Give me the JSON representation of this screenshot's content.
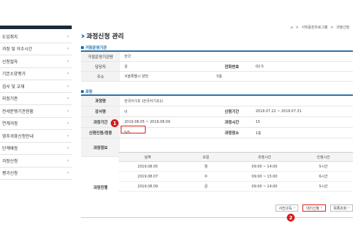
{
  "breadcrumb": {
    "home": "⌂",
    "sep1": ">",
    "item1": "사직동한프로그램",
    "sep2": ">",
    "item2": "과정신청"
  },
  "sidebar": {
    "items": [
      {
        "label": "도입취지"
      },
      {
        "label": "과정 및 이수시간"
      },
      {
        "label": "신청절차"
      },
      {
        "label": "기본소양평가"
      },
      {
        "label": "검사 및 교재"
      },
      {
        "label": "지정기준"
      },
      {
        "label": "전세분쟁기관현황"
      },
      {
        "label": "연계과정"
      },
      {
        "label": "영주귀화신청안내"
      },
      {
        "label": "단계배정"
      },
      {
        "label": "과정신청"
      },
      {
        "label": "평가신청"
      }
    ]
  },
  "page": {
    "title": "과정신청 관리"
  },
  "org_section": {
    "title": "거점운영기관",
    "name_label": "거점운영기관명",
    "name_value": "한국",
    "manager_label": "담당자",
    "manager_value": "김",
    "phone_label": "전화번호",
    "phone_value": "02-5",
    "address_label": "주소",
    "address_value": "서울특별시 양천",
    "address_extra": "5층"
  },
  "course_section": {
    "title": "과정",
    "course_label": "과정명",
    "course_value": "한국어기초 (한국어기초1)",
    "instructor_label": "강사명",
    "instructor_value": "이",
    "apply_period_label": "신청기간",
    "apply_period_value": "2019.07.22 ~ 2019.07.31",
    "course_period_label": "과정기간",
    "course_period_value": "2019.08.05 ~ 2019.08.09",
    "course_hours_label": "과정시간",
    "course_hours_value": "15",
    "capacity_label": "신청인원/정원",
    "capacity_value": "5/5",
    "location_label": "과정장소",
    "location_value": "1층",
    "info_label": "과정정보",
    "schedule_label": "과정진행"
  },
  "schedule": {
    "headers": [
      "날짜",
      "요일",
      "과정시간",
      "인정시간"
    ],
    "rows": [
      {
        "date": "2019.08.05",
        "day": "월",
        "time": "09:00 ~ 14:00",
        "credit": "5시간"
      },
      {
        "date": "2019.08.07",
        "day": "수",
        "time": "09:00 ~ 15:00",
        "credit": "6시간"
      },
      {
        "date": "2019.08.09",
        "day": "금",
        "time": "09:00 ~ 14:00",
        "credit": "5시간"
      }
    ]
  },
  "badges": {
    "one": "1",
    "two": "2"
  },
  "buttons": {
    "apply": "사전고득",
    "waitlist": "대기신청",
    "list": "목록조회",
    "arrow": "›"
  },
  "colors": {
    "accent": "#1a6fa6",
    "highlight": "#e01b1b",
    "sidebar_top": "#1b2a3b"
  }
}
